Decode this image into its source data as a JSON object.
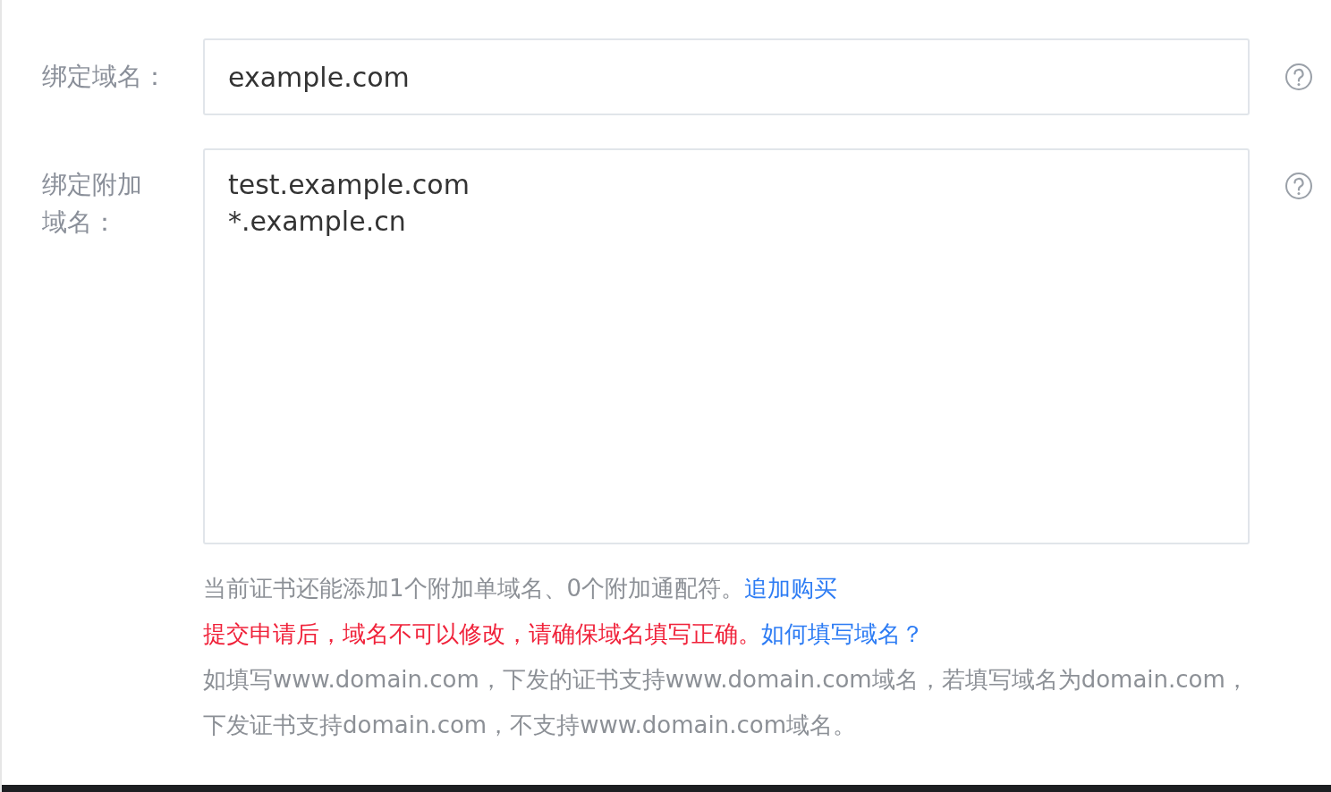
{
  "fields": [
    {
      "kind": "input",
      "label": "绑定域名：",
      "value": "example.com"
    },
    {
      "kind": "textarea",
      "label": "绑定附加域名：",
      "value": "test.example.com\n*.example.cn"
    }
  ],
  "quota_note": {
    "text": "当前证书还能添加1个附加单域名、0个附加通配符。",
    "link": "追加购买"
  },
  "warning": {
    "text": "提交申请后，域名不可以修改，请确保域名填写正确。",
    "link": "如何填写域名？"
  },
  "example_note": "如填写www.domain.com，下发的证书支持www.domain.com域名，若填写域名为domain.com，下发证书支持domain.com，不支持www.domain.com域名。"
}
